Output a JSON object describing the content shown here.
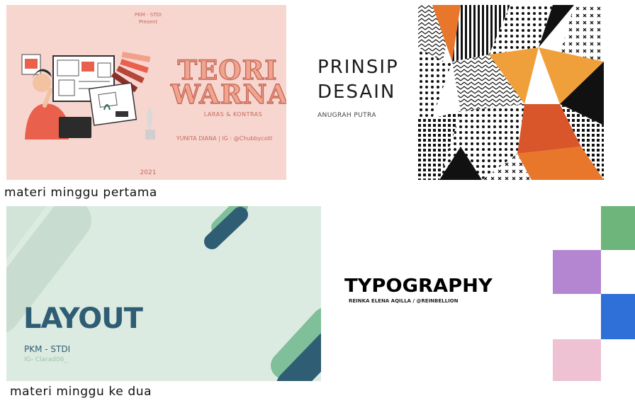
{
  "slides": [
    {
      "id": "teori-warna",
      "header_line1": "PKM - STDI",
      "header_line2": "Present",
      "title_line1": "TEORI",
      "title_line2": "WARNA",
      "subtitle": "LARAS & KONTRAS",
      "credit": "YUNITA DIANA  |  IG : @Chubbycolll",
      "year": "2021"
    },
    {
      "id": "prinsip-desain",
      "title_line1": "PRINSIP",
      "title_line2": "DESAIN",
      "author": "ANUGRAH PUTRA"
    },
    {
      "id": "layout",
      "title": "LAYOUT",
      "org": "PKM - STDI",
      "handle": "IG- Clarad06_"
    },
    {
      "id": "typography",
      "title": "TYPOGRAPHY",
      "author": "REINKA ELENA AQILLA / @REINBELLION"
    }
  ],
  "captions": {
    "week1": "materi minggu pertama",
    "week2": "materi minggu ke dua"
  },
  "colors": {
    "pink_bg": "#f7d6d0",
    "coral": "#c76a5a",
    "mint_bg": "#dcebe1",
    "teal_dark": "#2f5d73",
    "green": "#6db57b",
    "purple": "#b486d1",
    "blue": "#2e6fd8",
    "pink": "#eec1d3"
  }
}
